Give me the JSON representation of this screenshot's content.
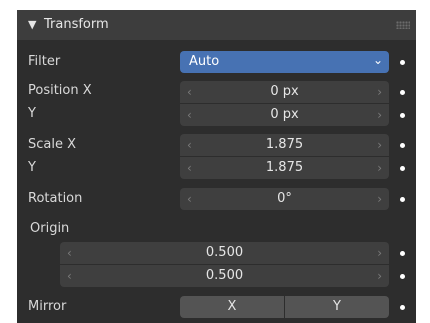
{
  "panel": {
    "title": "Transform"
  },
  "filter": {
    "label": "Filter",
    "value": "Auto"
  },
  "position": {
    "label_x": "Position X",
    "label_y": "Y",
    "x": "0 px",
    "y": "0 px"
  },
  "scale": {
    "label_x": "Scale X",
    "label_y": "Y",
    "x": "1.875",
    "y": "1.875"
  },
  "rotation": {
    "label": "Rotation",
    "value": "0°"
  },
  "origin": {
    "label": "Origin",
    "x": "0.500",
    "y": "0.500"
  },
  "mirror": {
    "label": "Mirror",
    "x": "X",
    "y": "Y"
  },
  "glyphs": {
    "left": "‹",
    "right": "›",
    "chevron": "⌄",
    "triangle": "▼"
  },
  "colors": {
    "accent": "#4772b3",
    "panel": "#2d2d2d",
    "header": "#3d3d3d",
    "field": "#545454"
  }
}
